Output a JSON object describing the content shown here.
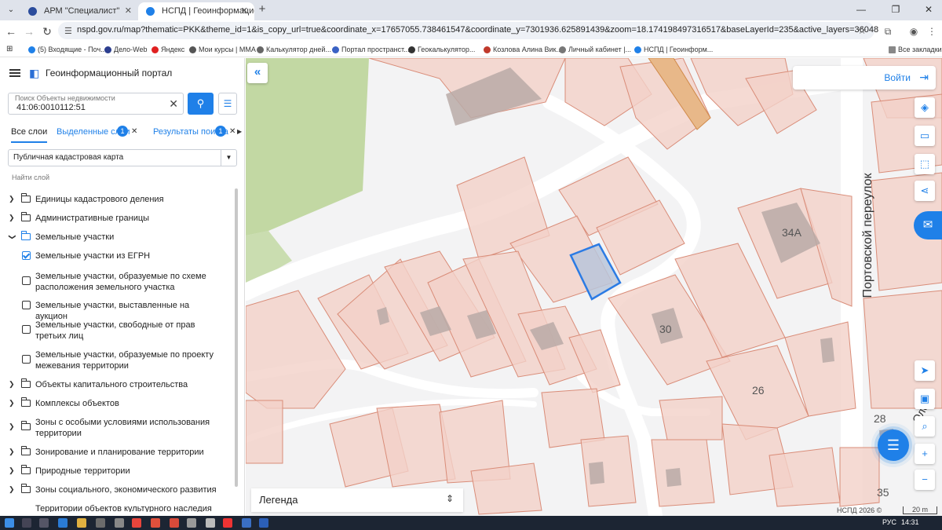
{
  "browser": {
    "tabs": [
      {
        "title": "АРМ \"Специалист\"",
        "active": false
      },
      {
        "title": "НСПД | Геоинформационный",
        "active": true
      }
    ],
    "url": "nspd.gov.ru/map?thematic=PKK&theme_id=1&is_copy_url=true&coordinate_x=17657055.738461547&coordinate_y=7301936.625891439&zoom=18.174198497316517&baseLayerId=235&active_layers=36048",
    "bookmarks": [
      "(5) Входящие - Поч...",
      "Дело-Web",
      "Яндекс",
      "Мои курсы | МMA",
      "Калькулятор дней...",
      "Портал пространст...",
      "Геокалькулятор...",
      "Козлова Алина Вик...",
      "Личный кабинет |...",
      "НСПД | Геоинформ..."
    ],
    "all_bookmarks": "Все закладки"
  },
  "app": {
    "title": "Геоинформационный портал",
    "search": {
      "placeholder": "Поиск Объекты недвижимости",
      "value": "41:06:0010112:51"
    },
    "tabs": [
      {
        "label": "Все слои"
      },
      {
        "label": "Выделенные слои",
        "badge": "1"
      },
      {
        "label": "Результаты поиска",
        "badge": "1"
      }
    ],
    "layer_select": "Публичная кадастровая карта",
    "find_layer": "Найти слой",
    "tree": [
      {
        "label": "Единицы кадастрового деления"
      },
      {
        "label": "Административные границы"
      },
      {
        "label": "Земельные участки"
      },
      {
        "label": "Земельные участки из ЕГРН"
      },
      {
        "label": "Земельные участки, образуемые по схеме расположения земельного участка"
      },
      {
        "label": "Земельные участки, выставленные на аукцион"
      },
      {
        "label": "Земельные участки, свободные от прав третьих лиц"
      },
      {
        "label": "Земельные участки, образуемые по проекту межевания территории"
      },
      {
        "label": "Объекты капитального строительства"
      },
      {
        "label": "Комплексы объектов"
      },
      {
        "label": "Зоны с особыми условиями использования территории"
      },
      {
        "label": "Зонирование и планирование территории"
      },
      {
        "label": "Природные территории"
      },
      {
        "label": "Зоны социального, экономического развития"
      },
      {
        "label": "Территории объектов культурного наследия"
      }
    ],
    "login": "Войти",
    "legend": "Легенда",
    "street": "Портовской переулок",
    "house_numbers": [
      "34А",
      "30",
      "26",
      "28",
      "35"
    ],
    "street_fragment": "Олега",
    "copyright": "НСПД 2026 ©",
    "scale": "20 m"
  },
  "taskbar": {
    "lang": "РУС",
    "time": "14:31"
  },
  "colors": {
    "accent": "#1f80e8",
    "parcel_stroke": "#d98c78",
    "parcel_fill": "#f2d1c8",
    "selected": "#2b7be4"
  }
}
